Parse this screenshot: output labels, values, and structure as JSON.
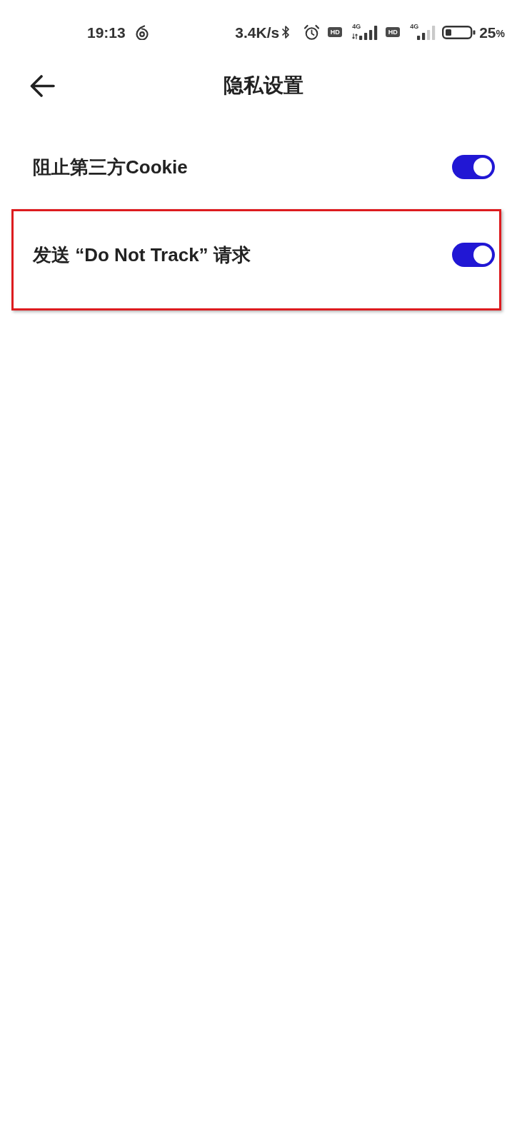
{
  "status_bar": {
    "time": "19:13",
    "network_speed": "3.4K/s",
    "sim_slots": [
      {
        "badge": "HD",
        "network_type": "4G",
        "data_active": true
      },
      {
        "badge": "HD",
        "network_type": "4G",
        "data_active": false
      }
    ],
    "battery_percent": "25",
    "percent_sign": "%"
  },
  "header": {
    "title": "隐私设置"
  },
  "settings": [
    {
      "label": "阻止第三方Cookie",
      "on": true,
      "highlighted": false
    },
    {
      "label": "发送 “Do Not Track” 请求",
      "on": true,
      "highlighted": true
    }
  ]
}
